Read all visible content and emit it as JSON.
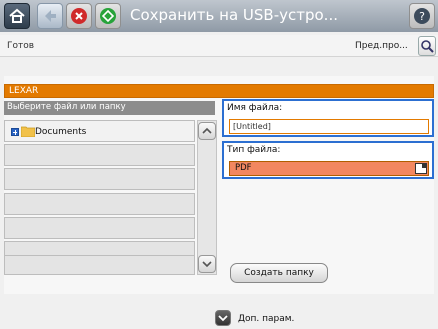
{
  "titlebar": {
    "title": "Сохранить на USB-устро...",
    "home_icon": "home-icon",
    "back_icon": "back-arrow-icon",
    "stop_icon": "stop-icon",
    "start_icon": "start-icon",
    "help_icon": "help-icon"
  },
  "status": {
    "text": "Готов",
    "preview_label": "Пред.про...",
    "preview_icon": "magnifier-icon"
  },
  "device": {
    "name": "LEXAR"
  },
  "file_list": {
    "header": "Выберите файл или папку",
    "items": [
      {
        "label": "Documents",
        "icon": "folder-icon",
        "expand_icon": "plus-icon"
      }
    ]
  },
  "file_name": {
    "label": "Имя файла:",
    "value": "[Untitled]"
  },
  "file_type": {
    "label": "Тип файла:",
    "value": "PDF",
    "icon": "dropdown-icon"
  },
  "actions": {
    "create_folder": "Создать папку"
  },
  "footer": {
    "more_options": "Доп. парам.",
    "more_icon": "chevron-down-icon"
  },
  "colors": {
    "accent_orange": "#e37a00",
    "select_blue": "#2c6fd1",
    "field_highlight": "#f28760"
  }
}
